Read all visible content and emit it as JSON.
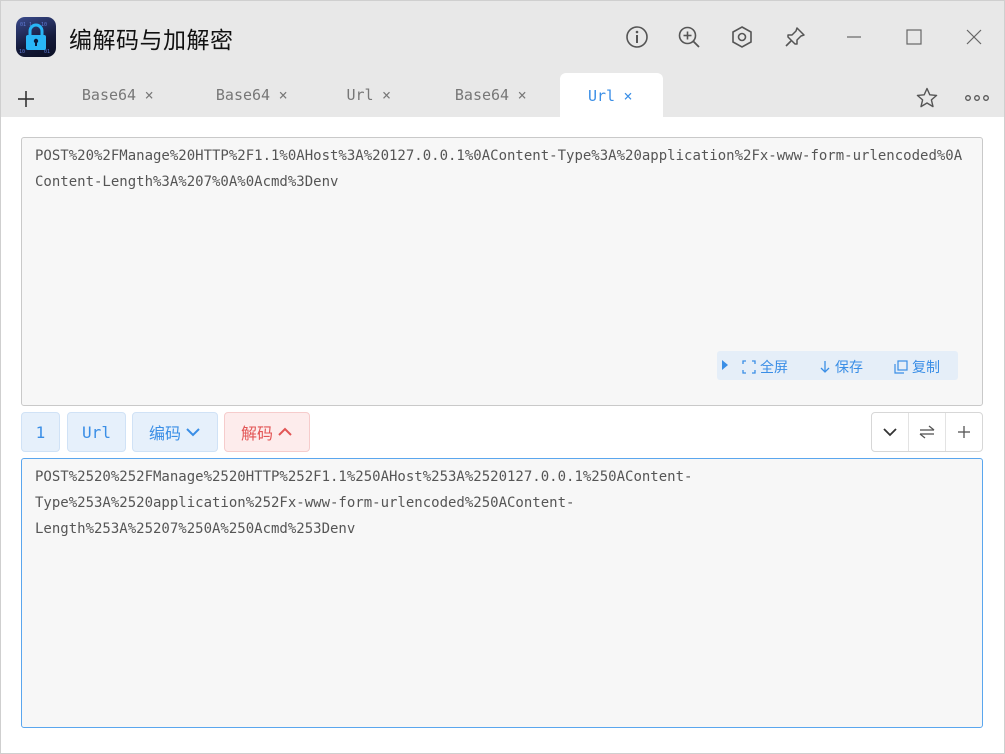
{
  "app": {
    "title": "编解码与加解密",
    "icon": "lock-app-icon"
  },
  "titlebar_buttons": [
    {
      "name": "info-icon"
    },
    {
      "name": "zoom-in-icon"
    },
    {
      "name": "hexagon-settings-icon"
    },
    {
      "name": "pin-icon"
    },
    {
      "name": "minimize-icon"
    },
    {
      "name": "maximize-icon"
    },
    {
      "name": "close-icon"
    }
  ],
  "tabs": [
    {
      "label": "Base64",
      "active": false
    },
    {
      "label": "Base64",
      "active": false
    },
    {
      "label": "Url",
      "active": false
    },
    {
      "label": "Base64",
      "active": false
    },
    {
      "label": "Url",
      "active": true
    }
  ],
  "tab_close_glyph": "×",
  "input": {
    "text": "POST%20%2FManage%20HTTP%2F1.1%0AHost%3A%20127.0.0.1%0AContent-Type%3A%20application%2Fx-www-form-urlencoded%0AContent-Length%3A%207%0A%0Acmd%3Denv"
  },
  "input_toolbar": {
    "fullscreen": "全屏",
    "save": "保存",
    "copy": "复制"
  },
  "controls": {
    "count": "1",
    "type": "Url",
    "encode": "编码",
    "decode": "解码"
  },
  "output": {
    "text": "POST%2520%252FManage%2520HTTP%252F1.1%250AHost%253A%2520127.0.0.1%250AContent-\nType%253A%2520application%252Fx-www-form-urlencoded%250AContent-\nLength%253A%25207%250A%250Acmd%253Denv"
  },
  "colors": {
    "accent": "#3a8ee6",
    "danger": "#e25555",
    "titlebar": "#e8e8e8"
  }
}
